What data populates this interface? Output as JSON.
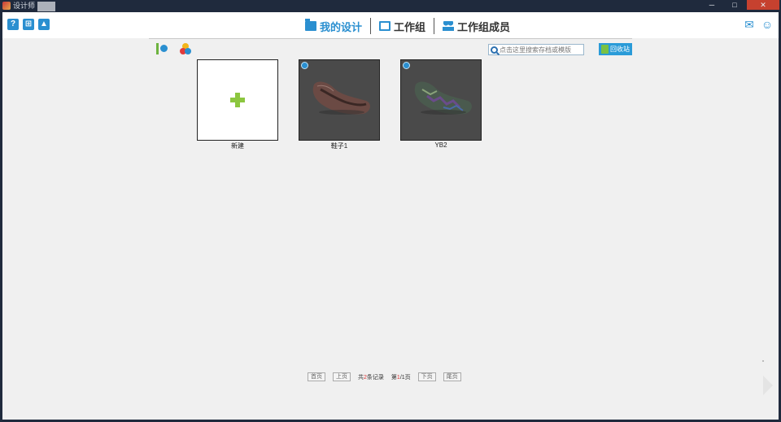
{
  "window": {
    "title": "设计师",
    "buttons": {
      "minimize": "─",
      "maximize": "□",
      "close": "✕"
    }
  },
  "topbar": {
    "left_icons": [
      "help-icon",
      "cart-icon",
      "user-upload-icon"
    ],
    "right_icons": [
      "mail-icon",
      "user-settings-icon"
    ]
  },
  "nav": {
    "tabs": [
      {
        "label": "我的设计",
        "icon": "folder-icon",
        "active": true
      },
      {
        "label": "工作组",
        "icon": "group-icon",
        "active": false
      },
      {
        "label": "工作组成员",
        "icon": "members-icon",
        "active": false
      }
    ]
  },
  "toolbar": {
    "search_placeholder": "点击这里搜索存档或模版",
    "recycle_label": "回收站"
  },
  "tiles": [
    {
      "label": "新建",
      "type": "new"
    },
    {
      "label": "鞋子1",
      "type": "design",
      "shoe_color": "#6b4a44"
    },
    {
      "label": "YB2",
      "type": "design",
      "shoe_color": "#4a5a4e"
    }
  ],
  "pager": {
    "first": "首页",
    "prev": "上页",
    "total_prefix": "共",
    "total_count": "2",
    "total_suffix": "条记录",
    "page_prefix": "第",
    "current": "1",
    "page_sep": "/",
    "page_total": "1",
    "page_suffix": "页",
    "next": "下页",
    "last": "尾页"
  }
}
